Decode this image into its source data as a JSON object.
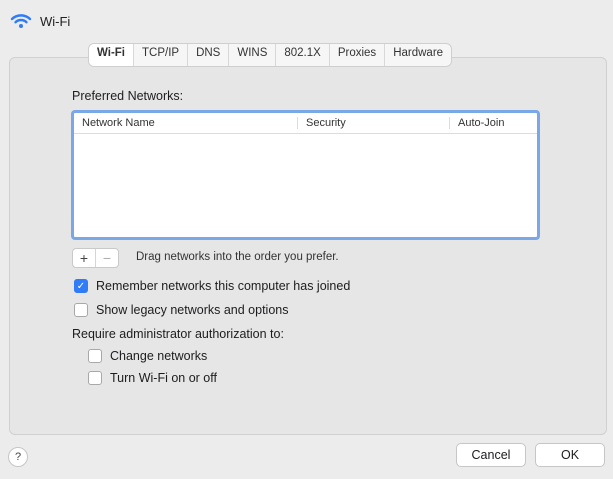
{
  "header": {
    "title": "Wi-Fi",
    "icon": "wifi-icon"
  },
  "tabs": [
    {
      "label": "Wi-Fi",
      "active": true
    },
    {
      "label": "TCP/IP",
      "active": false
    },
    {
      "label": "DNS",
      "active": false
    },
    {
      "label": "WINS",
      "active": false
    },
    {
      "label": "802.1X",
      "active": false
    },
    {
      "label": "Proxies",
      "active": false
    },
    {
      "label": "Hardware",
      "active": false
    }
  ],
  "preferred": {
    "label": "Preferred Networks:",
    "columns": [
      "Network Name",
      "Security",
      "Auto-Join"
    ],
    "rows": []
  },
  "list_controls": {
    "add": "+",
    "remove": "−",
    "hint": "Drag networks into the order you prefer."
  },
  "options": {
    "remember": {
      "label": "Remember networks this computer has joined",
      "checked": true
    },
    "legacy": {
      "label": "Show legacy networks and options",
      "checked": false
    },
    "require_label": "Require administrator authorization to:",
    "change": {
      "label": "Change networks",
      "checked": false
    },
    "toggle": {
      "label": "Turn Wi-Fi on or off",
      "checked": false
    }
  },
  "footer": {
    "help": "?",
    "cancel": "Cancel",
    "ok": "OK"
  },
  "colors": {
    "accent": "#2f7cf6",
    "focus_ring": "#7aa7e8"
  }
}
